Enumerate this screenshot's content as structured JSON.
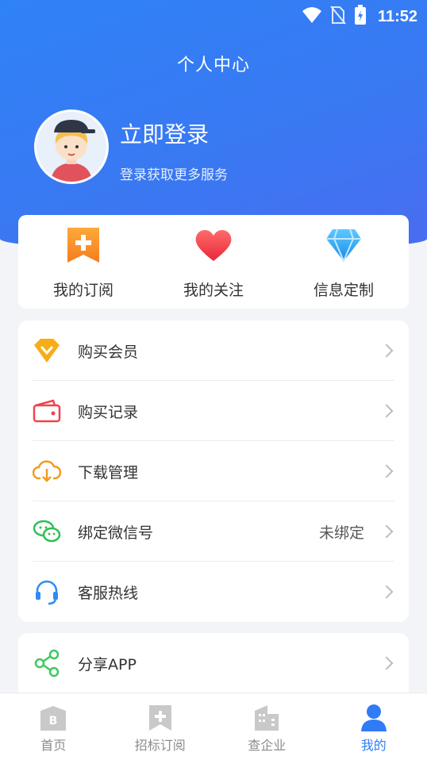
{
  "status_bar": {
    "time": "11:52"
  },
  "header": {
    "title": "个人中心",
    "login_title": "立即登录",
    "login_subtitle": "登录获取更多服务"
  },
  "quick_actions": [
    {
      "label": "我的订阅",
      "icon": "bookmark-plus-icon"
    },
    {
      "label": "我的关注",
      "icon": "heart-icon"
    },
    {
      "label": "信息定制",
      "icon": "diamond-icon"
    }
  ],
  "menu": {
    "items": [
      {
        "label": "购买会员",
        "icon": "vip-diamond-icon",
        "value": ""
      },
      {
        "label": "购买记录",
        "icon": "wallet-icon",
        "value": ""
      },
      {
        "label": "下载管理",
        "icon": "cloud-download-icon",
        "value": ""
      },
      {
        "label": "绑定微信号",
        "icon": "wechat-icon",
        "value": "未绑定"
      },
      {
        "label": "客服热线",
        "icon": "headset-icon",
        "value": ""
      }
    ],
    "share": {
      "label": "分享APP",
      "icon": "share-icon"
    }
  },
  "tabbar": {
    "tabs": [
      {
        "label": "首页",
        "icon": "home-icon"
      },
      {
        "label": "招标订阅",
        "icon": "subscribe-icon"
      },
      {
        "label": "查企业",
        "icon": "building-icon"
      },
      {
        "label": "我的",
        "icon": "user-icon",
        "active": true
      }
    ]
  },
  "colors": {
    "header_blue": "#2f82f6",
    "active_tab": "#2f7cf6",
    "orange": "#f59a23",
    "red": "#f2434b",
    "green": "#2fbf55"
  }
}
